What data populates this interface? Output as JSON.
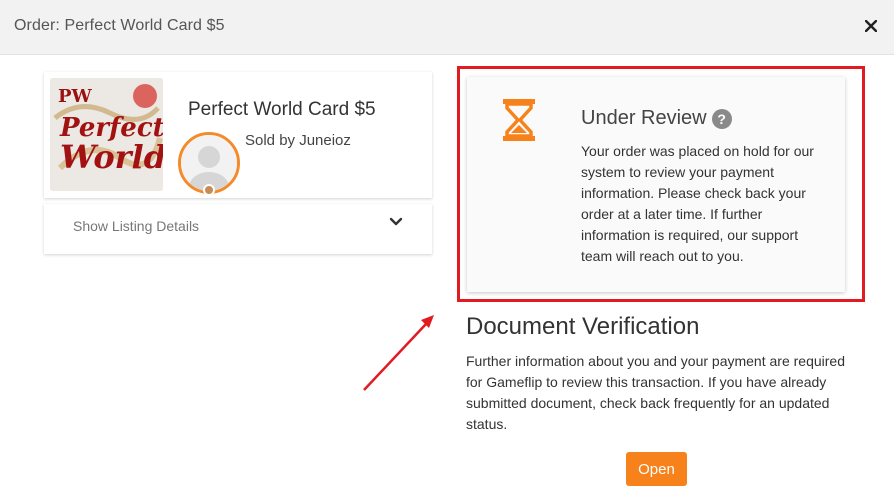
{
  "header": {
    "title": "Order: Perfect World Card $5"
  },
  "product": {
    "name": "Perfect World Card $5",
    "sold_by": "Sold by Juneioz",
    "thumbnail_logo_text": "Perfect World"
  },
  "listing": {
    "label": "Show Listing Details"
  },
  "review": {
    "title": "Under Review",
    "help_glyph": "?",
    "message": "Your order was placed on hold for our system to review your payment information. Please check back your order at a later time. If further information is required, our support team will reach out to you."
  },
  "document": {
    "title": "Document Verification",
    "message": "Further information about you and your payment are required for Gameflip to review this transaction. If you have already submitted document, check back frequently for an updated status.",
    "open_label": "Open"
  },
  "colors": {
    "accent": "#f7821b",
    "highlight": "#e11b22",
    "header_bg": "#f2f2f2"
  },
  "icons": [
    "close-icon",
    "chevron-down-icon",
    "hourglass-icon",
    "help-icon",
    "avatar-icon",
    "arrow-annotation"
  ]
}
